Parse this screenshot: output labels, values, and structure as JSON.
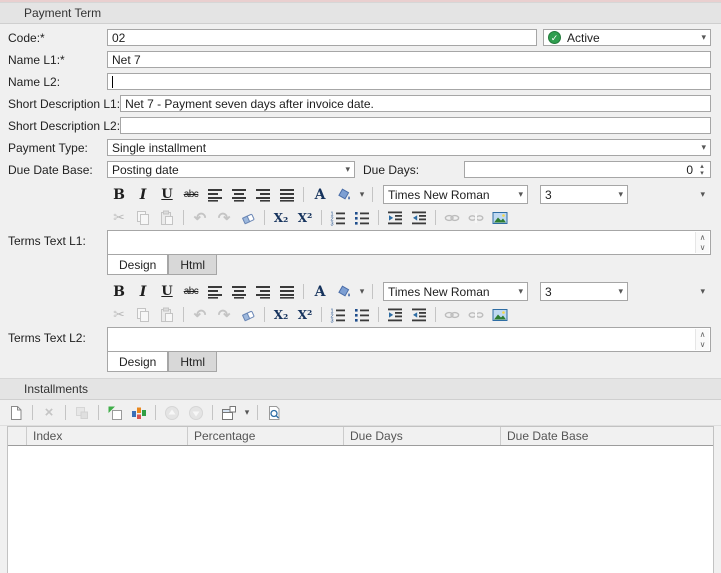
{
  "icons": {
    "dropdown": "▾",
    "check": "✓",
    "scroll_up": "∧",
    "scroll_down": "∨",
    "spin_up": "▴",
    "spin_down": "▾"
  },
  "payment_term": {
    "header": "Payment Term",
    "code": {
      "label": "Code:*",
      "value": "02"
    },
    "status": {
      "value": "Active"
    },
    "name_l1": {
      "label": "Name L1:*",
      "value": "Net 7"
    },
    "name_l2": {
      "label": "Name L2:",
      "value": ""
    },
    "short_desc_l1": {
      "label": "Short Description L1:",
      "value": "Net 7 - Payment seven days after invoice date."
    },
    "short_desc_l2": {
      "label": "Short Description L2:",
      "value": ""
    },
    "payment_type": {
      "label": "Payment Type:",
      "value": "Single installment"
    },
    "due_date_base": {
      "label": "Due Date Base:",
      "value": "Posting date"
    },
    "due_days": {
      "label": "Due Days:",
      "value": "0"
    }
  },
  "editor": {
    "terms_l1_label": "Terms Text L1:",
    "terms_l2_label": "Terms Text L2:",
    "font_name": "Times New Roman",
    "font_size": "3",
    "tabs": {
      "design": "Design",
      "html": "Html"
    },
    "toolbar_row1": [
      {
        "name": "bold-button",
        "glyph": "B",
        "cls": "g-b"
      },
      {
        "name": "italic-button",
        "glyph": "I",
        "cls": "g-i"
      },
      {
        "name": "underline-button",
        "glyph": "U",
        "cls": "g-u"
      },
      {
        "name": "strikethrough-button",
        "glyph": "abc",
        "cls": "g-s"
      },
      {
        "name": "align-left-button",
        "sym": "align-left"
      },
      {
        "name": "align-center-button",
        "sym": "align-center"
      },
      {
        "name": "align-right-button",
        "sym": "align-right"
      },
      {
        "name": "align-justify-button",
        "sym": "align-justify"
      },
      {
        "sep": true
      },
      {
        "name": "font-color-button",
        "glyph": "A",
        "cls": "g-a"
      },
      {
        "name": "fill-color-button",
        "sym": "bucket"
      },
      {
        "name": "color-dropdown-arrow",
        "glyph": "▾",
        "cls": "g-dd"
      },
      {
        "sep": true
      }
    ],
    "toolbar_row2": [
      {
        "name": "cut-button",
        "glyph": "✂",
        "cls": "g-cut",
        "dis": true
      },
      {
        "name": "copy-button",
        "sym": "copy",
        "dis": true
      },
      {
        "name": "paste-button",
        "sym": "paste",
        "dis": true
      },
      {
        "sep": true
      },
      {
        "name": "undo-button",
        "glyph": "↶",
        "cls": "g-ur",
        "dis": true
      },
      {
        "name": "redo-button",
        "glyph": "↷",
        "cls": "g-ur",
        "dis": true
      },
      {
        "name": "clear-formatting-button",
        "sym": "eraser"
      },
      {
        "sep": true
      },
      {
        "name": "subscript-button",
        "glyph": "X₂",
        "cls": "g-x"
      },
      {
        "name": "superscript-button",
        "glyph": "X²",
        "cls": "g-x"
      },
      {
        "sep": true
      },
      {
        "name": "numbered-list-button",
        "sym": "list-num"
      },
      {
        "name": "bullet-list-button",
        "sym": "list-bul"
      },
      {
        "sep": true
      },
      {
        "name": "indent-button",
        "sym": "indent"
      },
      {
        "name": "outdent-button",
        "sym": "outdent"
      },
      {
        "sep": true
      },
      {
        "name": "insert-link-button",
        "sym": "link",
        "dis": true
      },
      {
        "name": "remove-link-button",
        "sym": "unlink",
        "dis": true
      },
      {
        "name": "insert-image-button",
        "sym": "image"
      }
    ]
  },
  "installments": {
    "header": "Installments",
    "toolbar": [
      {
        "name": "new-installment-button",
        "sym": "new-doc"
      },
      {
        "sep": true
      },
      {
        "name": "delete-installment-button",
        "glyph": "×",
        "cls": "g-del",
        "dis": true
      },
      {
        "sep": true
      },
      {
        "name": "duplicate-installment-button",
        "sym": "dup",
        "dis": true
      },
      {
        "sep": true
      },
      {
        "name": "add-new-row-button",
        "sym": "add-new"
      },
      {
        "name": "view-settings-button",
        "sym": "tiles"
      },
      {
        "sep": true
      },
      {
        "name": "move-up-button",
        "sym": "up-circle",
        "dis": true
      },
      {
        "name": "move-down-button",
        "sym": "down-circle",
        "dis": true
      },
      {
        "sep": true
      },
      {
        "name": "layout-button",
        "sym": "layout"
      },
      {
        "name": "layout-dropdown-arrow",
        "glyph": "▾",
        "cls": "g-dd"
      },
      {
        "sep": true
      },
      {
        "name": "preview-button",
        "sym": "preview"
      }
    ],
    "columns": [
      "Index",
      "Percentage",
      "Due Days",
      "Due Date Base"
    ],
    "rows": []
  }
}
